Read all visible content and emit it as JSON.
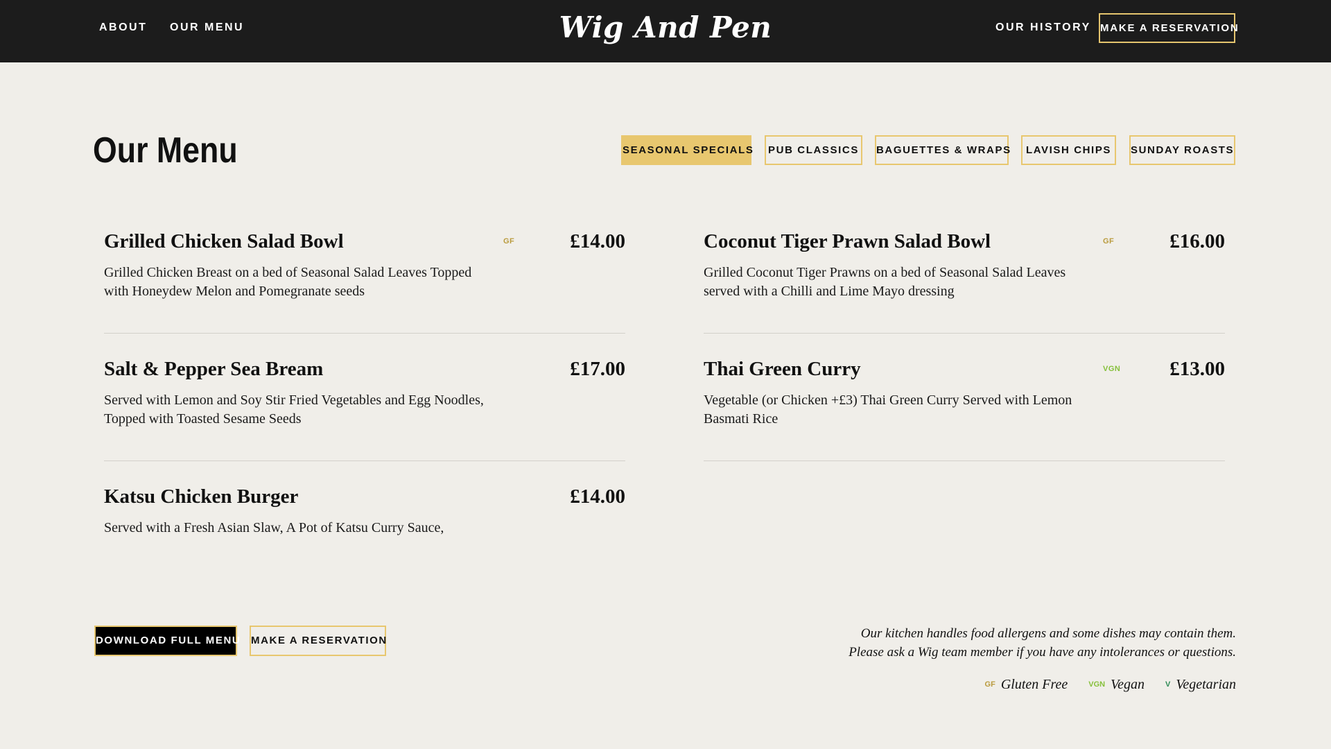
{
  "header": {
    "nav_left": [
      "About",
      "Our Menu"
    ],
    "logo": "Wig And Pen",
    "nav_history": "Our History",
    "nav_reserve": "Make A Reservation"
  },
  "page": {
    "title": "Our Menu"
  },
  "tabs": [
    {
      "label": "Seasonal Specials",
      "active": true
    },
    {
      "label": "Pub Classics",
      "active": false
    },
    {
      "label": "Baguettes & Wraps",
      "active": false
    },
    {
      "label": "Lavish Chips",
      "active": false
    },
    {
      "label": "Sunday Roasts",
      "active": false
    }
  ],
  "menu_items": [
    {
      "name": "Grilled Chicken Salad Bowl",
      "price": "£14.00",
      "tag": "GF",
      "description": "Grilled Chicken Breast on a bed of Seasonal Salad Leaves Topped with Honeydew Melon and Pomegranate seeds"
    },
    {
      "name": "Coconut Tiger Prawn Salad Bowl",
      "price": "£16.00",
      "tag": "GF",
      "description": "Grilled Coconut Tiger Prawns on a bed of Seasonal Salad Leaves served with a Chilli and Lime Mayo dressing"
    },
    {
      "name": "Salt & Pepper Sea Bream",
      "price": "£17.00",
      "tag": "",
      "description": "Served with Lemon and Soy Stir Fried Vegetables and Egg Noodles, Topped with Toasted Sesame Seeds"
    },
    {
      "name": "Thai Green Curry",
      "price": "£13.00",
      "tag": "VGN",
      "description": "Vegetable (or Chicken +£3) Thai Green Curry Served with Lemon Basmati Rice"
    },
    {
      "name": "Katsu Chicken Burger",
      "price": "£14.00",
      "tag": "",
      "description": "Served with a Fresh Asian Slaw, A Pot of Katsu Curry Sauce,"
    }
  ],
  "footer": {
    "download_label": "Download Full Menu",
    "reserve_label": "Make A Reservation",
    "notice_line1": "Our kitchen handles food allergens and some dishes may contain them.",
    "notice_line2": "Please ask a Wig team member if you have any intolerances or questions.",
    "legend": [
      {
        "code": "GF",
        "label": "Gluten Free",
        "color": "#b99a3c"
      },
      {
        "code": "VGN",
        "label": "Vegan",
        "color": "#86c03b"
      },
      {
        "code": "V",
        "label": "Vegetarian",
        "color": "#2e8b57"
      }
    ]
  },
  "colors": {
    "accent_gold": "#e8c76f",
    "header_bg": "#1c1c1c",
    "page_bg": "#f0eee9"
  }
}
